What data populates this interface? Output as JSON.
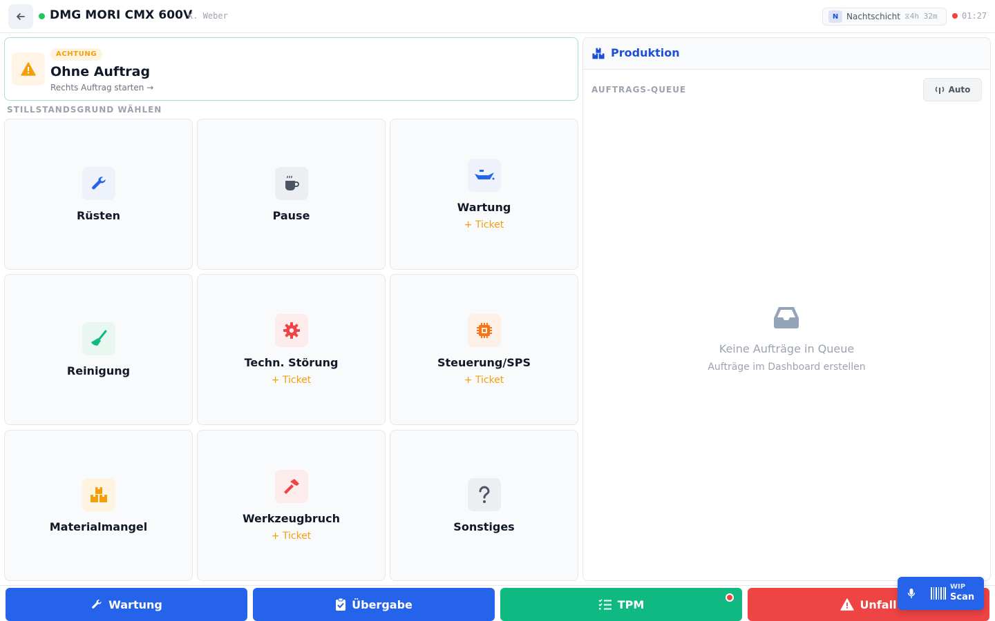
{
  "header": {
    "machine_title": "DMG MORI CMX 600V",
    "user": "K. Weber",
    "shift_badge": "N",
    "shift_name": "Nachtschicht",
    "shift_time": "⧖4h 32m",
    "clock": "01:27"
  },
  "warning": {
    "badge": "ACHTUNG",
    "title": "Ohne Auftrag",
    "subtitle": "Rechts Auftrag starten →"
  },
  "reasons_label": "STILLSTANDSGRUND WÄHLEN",
  "reasons": [
    {
      "label": "Rüsten",
      "ticket": "",
      "icon": "wrench-icon"
    },
    {
      "label": "Pause",
      "ticket": "",
      "icon": "coffee-icon"
    },
    {
      "label": "Wartung",
      "ticket": "+ Ticket",
      "icon": "oil-can-icon"
    },
    {
      "label": "Reinigung",
      "ticket": "",
      "icon": "broom-icon"
    },
    {
      "label": "Techn. Störung",
      "ticket": "+ Ticket",
      "icon": "gear-icon"
    },
    {
      "label": "Steuerung/SPS",
      "ticket": "+ Ticket",
      "icon": "chip-icon"
    },
    {
      "label": "Materialmangel",
      "ticket": "",
      "icon": "boxes-icon"
    },
    {
      "label": "Werkzeugbruch",
      "ticket": "+ Ticket",
      "icon": "hammer-icon"
    },
    {
      "label": "Sonstiges",
      "ticket": "",
      "icon": "question-icon"
    }
  ],
  "panel": {
    "title": "Produktion",
    "queue_label": "AUFTRAGS-QUEUE",
    "auto_label": "Auto",
    "empty_title": "Keine Aufträge in Queue",
    "empty_subtitle": "Aufträge im Dashboard erstellen"
  },
  "bottom": {
    "wartung": "Wartung",
    "uebergabe": "Übergabe",
    "tpm": "TPM",
    "unfall": "Unfall"
  },
  "wip": {
    "small": "WIP",
    "big": "Scan"
  },
  "colors": {
    "primary": "#2563eb",
    "success": "#10b981",
    "danger": "#ef4444",
    "warning": "#f59e0b"
  }
}
